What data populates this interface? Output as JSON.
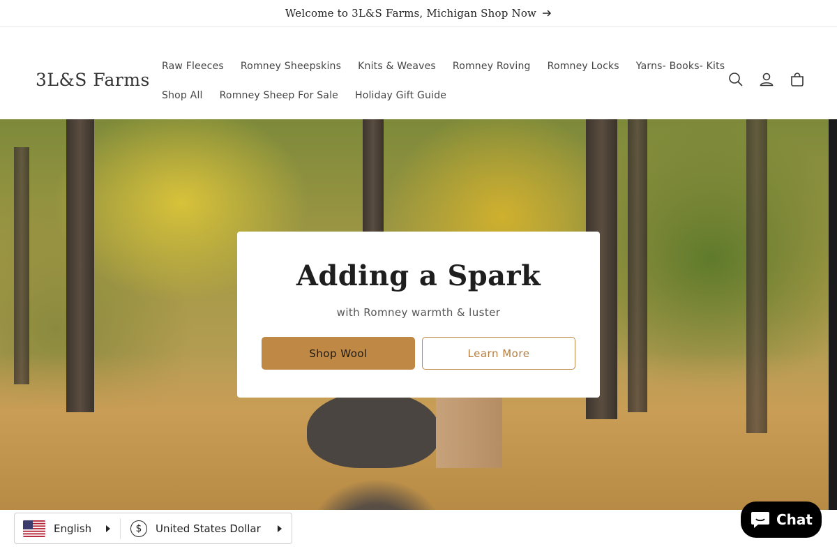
{
  "announcement": {
    "text": "Welcome to 3L&S Farms, Michigan Shop Now",
    "icon": "arrow-right-icon"
  },
  "header": {
    "logo": "3L&S Farms",
    "nav_row1": [
      "Raw Fleeces",
      "Romney Sheepskins",
      "Knits & Weaves",
      "Romney Roving",
      "Romney Locks",
      "Yarns- Books- Kits"
    ],
    "nav_row2": [
      "Shop All",
      "Romney Sheep For Sale",
      "Holiday Gift Guide"
    ],
    "icons": [
      "search-icon",
      "account-icon",
      "cart-icon"
    ]
  },
  "hero": {
    "title": "Adding a Spark",
    "subtitle": "with Romney warmth & luster",
    "primary_button": "Shop Wool",
    "secondary_button": "Learn More"
  },
  "selectors": {
    "language": "English",
    "currency": "United States Dollar",
    "currency_symbol": "$"
  },
  "chat": {
    "label": "Chat",
    "icon": "chat-bubble-icon"
  },
  "colors": {
    "accent": "#bf8844",
    "text": "#121212",
    "chat_bg": "#000000"
  }
}
